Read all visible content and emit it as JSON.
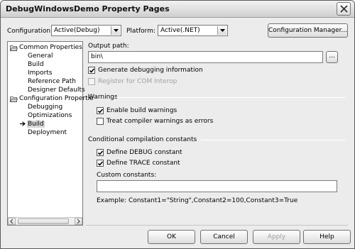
{
  "window": {
    "title": "DebugWindowsDemo Property Pages"
  },
  "toolbar": {
    "configuration_label": "Configuration:",
    "configuration_value": "Active(Debug)",
    "platform_label": "Platform:",
    "platform_value": "Active(.NET)",
    "config_manager_label": "Configuration Manager..."
  },
  "tree": {
    "groups": [
      {
        "label": "Common Properties",
        "items": [
          "General",
          "Build",
          "Imports",
          "Reference Path",
          "Designer Defaults"
        ]
      },
      {
        "label": "Configuration Propertie",
        "items": [
          "Debugging",
          "Optimizations",
          "Build",
          "Deployment"
        ]
      }
    ],
    "selected": "Build"
  },
  "build": {
    "output_path_label": "Output path:",
    "output_path_value": "bin\\",
    "browse_label": "...",
    "generate_debug_label": "Generate debugging information",
    "generate_debug_checked": true,
    "register_com_label": "Register for COM Interop",
    "register_com_checked": false,
    "register_com_enabled": false
  },
  "warnings": {
    "section_label": "Warnings",
    "enable_build_warnings_label": "Enable build warnings",
    "enable_build_warnings_checked": true,
    "treat_as_errors_label": "Treat compiler warnings as errors",
    "treat_as_errors_checked": false
  },
  "constants": {
    "section_label": "Conditional compilation constants",
    "define_debug_label": "Define DEBUG constant",
    "define_debug_checked": true,
    "define_trace_label": "Define TRACE constant",
    "define_trace_checked": true,
    "custom_label": "Custom constants:",
    "custom_value": "",
    "example_text": "Example: Constant1=\"String\",Constant2=100,Constant3=True"
  },
  "footer": {
    "ok_label": "OK",
    "cancel_label": "Cancel",
    "apply_label": "Apply",
    "help_label": "Help"
  }
}
